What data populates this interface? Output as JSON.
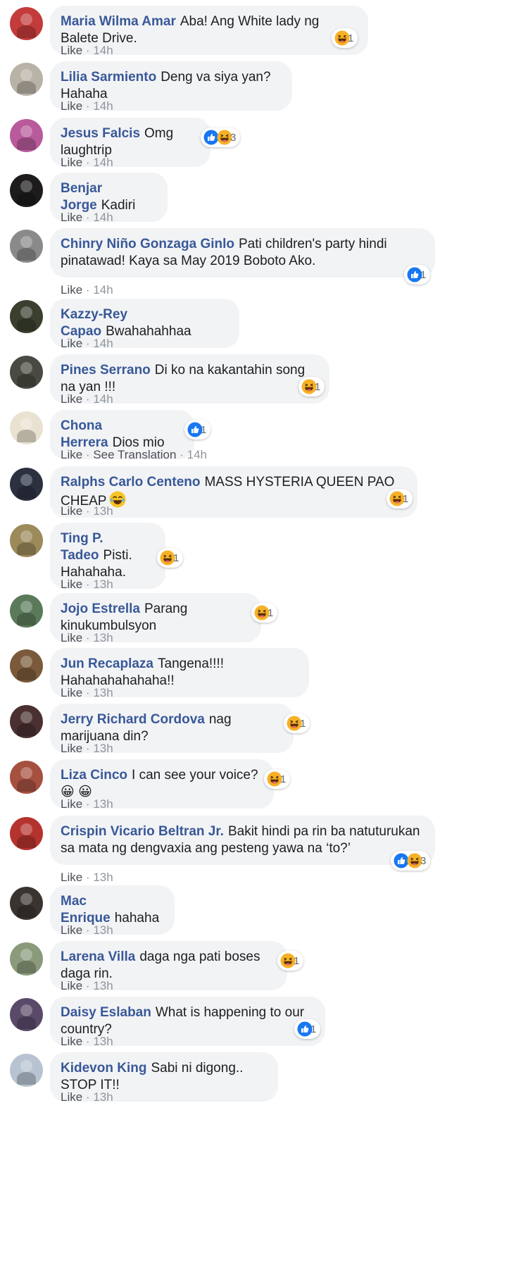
{
  "actions": {
    "like": "Like",
    "separator": "·",
    "see_translation": "See Translation"
  },
  "comments": [
    {
      "author": "Maria Wilma Amar",
      "text": "Aba! Ang White lady ng Balete Drive.",
      "time": "14h",
      "avatar_color": "#c33b3b",
      "reactions": [
        "haha"
      ],
      "reaction_count": "1"
    },
    {
      "author": "Lilia Sarmiento",
      "text": "Deng va siya yan? Hahaha",
      "time": "14h",
      "avatar_color": "#b9b2a6",
      "reactions": [],
      "reaction_count": ""
    },
    {
      "author": "Jesus Falcis",
      "text": "Omg laughtrip",
      "time": "14h",
      "avatar_color": "#b85a9b",
      "reactions": [
        "like",
        "haha"
      ],
      "reaction_count": "3"
    },
    {
      "author": "Benjar Jorge",
      "text": "Kadiri",
      "time": "14h",
      "avatar_color": "#1d1b1b",
      "reactions": [],
      "reaction_count": ""
    },
    {
      "author": "Chinry Niño Gonzaga Ginlo",
      "text": "Pati children's party hindi pinatawad! Kaya sa May 2019 Boboto Ako.",
      "time": "14h",
      "avatar_color": "#8a8a8a",
      "reactions": [
        "like"
      ],
      "reaction_count": "1"
    },
    {
      "author": "Kazzy-Rey Capao",
      "text": "Bwahahahhaa",
      "time": "14h",
      "avatar_color": "#3a3f2e",
      "reactions": [],
      "reaction_count": ""
    },
    {
      "author": "Pines Serrano",
      "text": "Di ko na kakantahin song na yan !!!",
      "time": "14h",
      "avatar_color": "#4a4a42",
      "reactions": [
        "haha"
      ],
      "reaction_count": "1"
    },
    {
      "author": "Chona Herrera",
      "text": "Dios mio",
      "time": "14h",
      "avatar_color": "#e9e2d0",
      "reactions": [
        "like"
      ],
      "reaction_count": "1",
      "see_translation": true
    },
    {
      "author": "Ralphs Carlo Centeno",
      "text": "MASS HYSTERIA QUEEN PAO CHEAP",
      "time": "13h",
      "avatar_color": "#2c3140",
      "reactions": [
        "haha"
      ],
      "reaction_count": "1",
      "inline_emoji": "joy"
    },
    {
      "author": "Ting P. Tadeo",
      "text": "Pisti. Hahahaha.",
      "time": "13h",
      "avatar_color": "#9c8a5a",
      "reactions": [
        "haha"
      ],
      "reaction_count": "1"
    },
    {
      "author": "Jojo Estrella",
      "text": "Parang kinukumbulsyon",
      "time": "13h",
      "avatar_color": "#5a7a5a",
      "reactions": [
        "haha"
      ],
      "reaction_count": "1"
    },
    {
      "author": "Jun Recaplaza",
      "text": "Tangena!!!! Hahahahahahaha!!",
      "time": "13h",
      "avatar_color": "#7a5a3a",
      "reactions": [],
      "reaction_count": ""
    },
    {
      "author": "Jerry Richard Cordova",
      "text": "nag marijuana din?",
      "time": "13h",
      "avatar_color": "#4a3030",
      "reactions": [
        "haha"
      ],
      "reaction_count": "1"
    },
    {
      "author": "Liza Cinco",
      "text": "I can see your voice? 😀 😀",
      "time": "13h",
      "avatar_color": "#a65040",
      "reactions": [
        "haha"
      ],
      "reaction_count": "1"
    },
    {
      "author": "Crispin Vicario Beltran Jr.",
      "text": "Bakit hindi pa rin ba natuturukan sa mata ng dengvaxia ang pesteng yawa na ‘to?’",
      "time": "13h",
      "avatar_color": "#b5332e",
      "reactions": [
        "like",
        "haha"
      ],
      "reaction_count": "3"
    },
    {
      "author": "Mac Enrique",
      "text": "hahaha",
      "time": "13h",
      "avatar_color": "#3a3430",
      "reactions": [],
      "reaction_count": ""
    },
    {
      "author": "Larena Villa",
      "text": "daga nga pati boses daga rin.",
      "time": "13h",
      "avatar_color": "#8a9a7a",
      "reactions": [
        "haha"
      ],
      "reaction_count": "1"
    },
    {
      "author": "Daisy Eslaban",
      "text": "What is happening to our country?",
      "time": "13h",
      "avatar_color": "#5a4a6a",
      "reactions": [
        "like"
      ],
      "reaction_count": "1"
    },
    {
      "author": "Kidevon King",
      "text": "Sabi ni digong.. STOP IT!!",
      "time": "13h",
      "avatar_color": "#b7c3d0",
      "reactions": [],
      "reaction_count": ""
    }
  ]
}
